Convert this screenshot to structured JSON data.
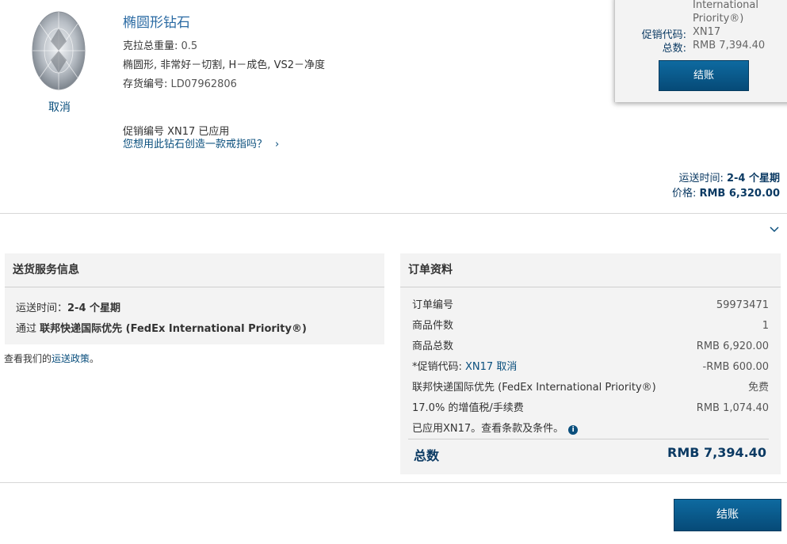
{
  "product": {
    "title": "椭圆形钻石",
    "carat_label": "克拉总重量",
    "carat_value": "0.5",
    "spec": "椭圆形, 非常好－切割, H－成色, VS2－净度",
    "stock_label": "存货编号",
    "stock_value": "LD07962806",
    "cancel": "取消",
    "promo_applied": "促销编号 XN17 已应用",
    "ring_question": "您想用此钻石创造一款戒指吗？",
    "ring_chevron": "›",
    "ship_time_label": "运送时间:",
    "ship_time_value": "2-4 个星期",
    "price_label": "价格:",
    "price_value": "RMB 6,320.00",
    "expand_icon": "chevron-down-icon"
  },
  "popup": {
    "shipping_method_line1": "International",
    "shipping_method_line2": "Priority®)",
    "promo_label": "促销代码:",
    "promo_value": "XN17",
    "total_label": "总数:",
    "total_value": "RMB 7,394.40",
    "checkout": "结账"
  },
  "shipping_panel": {
    "title": "送货服务信息",
    "time_label": "运送时间：",
    "time_value": "2-4 个星期",
    "via_prefix": "通过",
    "via_value": "联邦快递国际优先 (FedEx International Priority®)",
    "policy_prefix": "查看我们的",
    "policy_link": "运送政策",
    "policy_suffix": "。"
  },
  "order_panel": {
    "title": "订单资料",
    "rows": [
      {
        "label": "订单编号",
        "value": "59973471"
      },
      {
        "label": "商品件数",
        "value": "1"
      },
      {
        "label": "商品总数",
        "value": "RMB 6,920.00"
      },
      {
        "label": "*促销代码:",
        "code": "XN17",
        "cancel": "取消",
        "value": "-RMB 600.00"
      },
      {
        "label": "联邦快递国际优先 (FedEx International Priority®)",
        "value": "免费"
      },
      {
        "label": "17.0% 的增值税/手续费",
        "value": "RMB 1,074.40"
      },
      {
        "label": "已应用XN17。查看条款及条件。",
        "value": ""
      }
    ],
    "total_label": "总数",
    "total_value": "RMB 7,394.40",
    "info_icon": "info-icon"
  },
  "checkout_bottom": "结账",
  "colors": {
    "navy": "#0b3a63",
    "link": "#0a4f7d",
    "button": "#064a77",
    "panel_bg": "#f3f3f3"
  }
}
